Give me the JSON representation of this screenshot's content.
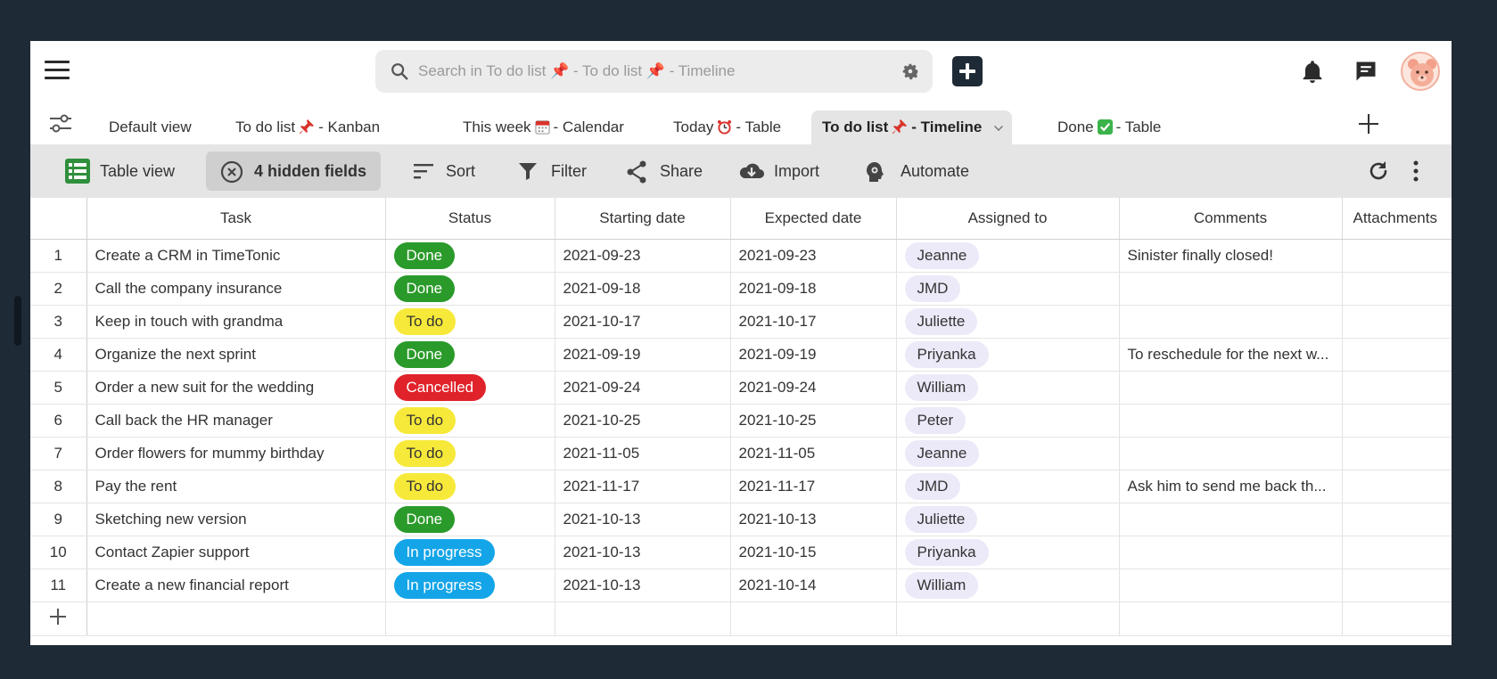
{
  "topbar": {
    "search_placeholder": "Search in To do list 📌 - To do list 📌 - Timeline"
  },
  "tabs": [
    {
      "label": "Default view"
    },
    {
      "label": "To do list",
      "suffix": "- Kanban"
    },
    {
      "label": "This week",
      "suffix": "- Calendar"
    },
    {
      "label": "Today",
      "suffix": "- Table"
    },
    {
      "label": "To do list",
      "suffix": "- Timeline"
    },
    {
      "label": "Done",
      "suffix": "- Table"
    }
  ],
  "toolbar": {
    "table_view": "Table view",
    "hidden_fields": "4 hidden fields",
    "sort": "Sort",
    "filter": "Filter",
    "share": "Share",
    "import": "Import",
    "automate": "Automate"
  },
  "columns": [
    "Task",
    "Status",
    "Starting date",
    "Expected date",
    "Assigned to",
    "Comments",
    "Attachments"
  ],
  "status_colors": {
    "Done": {
      "bg": "#2a9a2a",
      "fg": "#ffffff"
    },
    "To do": {
      "bg": "#f7e93a",
      "fg": "#333333"
    },
    "Cancelled": {
      "bg": "#e0222a",
      "fg": "#ffffff"
    },
    "In progress": {
      "bg": "#14a5e8",
      "fg": "#ffffff"
    }
  },
  "rows": [
    {
      "n": "1",
      "task": "Create a CRM in TimeTonic",
      "status": "Done",
      "start": "2021-09-23",
      "expected": "2021-09-23",
      "assigned": "Jeanne",
      "comment": "Sinister finally closed!"
    },
    {
      "n": "2",
      "task": "Call the company insurance",
      "status": "Done",
      "start": "2021-09-18",
      "expected": "2021-09-18",
      "assigned": "JMD",
      "comment": ""
    },
    {
      "n": "3",
      "task": "Keep in touch with grandma",
      "status": "To do",
      "start": "2021-10-17",
      "expected": "2021-10-17",
      "assigned": "Juliette",
      "comment": ""
    },
    {
      "n": "4",
      "task": "Organize the next sprint",
      "status": "Done",
      "start": "2021-09-19",
      "expected": "2021-09-19",
      "assigned": "Priyanka",
      "comment": "To reschedule for the next w..."
    },
    {
      "n": "5",
      "task": "Order a new suit for the wedding",
      "status": "Cancelled",
      "start": "2021-09-24",
      "expected": "2021-09-24",
      "assigned": "William",
      "comment": ""
    },
    {
      "n": "6",
      "task": "Call back the HR manager",
      "status": "To do",
      "start": "2021-10-25",
      "expected": "2021-10-25",
      "assigned": "Peter",
      "comment": ""
    },
    {
      "n": "7",
      "task": "Order flowers for mummy birthday",
      "status": "To do",
      "start": "2021-11-05",
      "expected": "2021-11-05",
      "assigned": "Jeanne",
      "comment": ""
    },
    {
      "n": "8",
      "task": "Pay the rent",
      "status": "To do",
      "start": "2021-11-17",
      "expected": "2021-11-17",
      "assigned": "JMD",
      "comment": "Ask him to send me back th..."
    },
    {
      "n": "9",
      "task": "Sketching new version",
      "status": "Done",
      "start": "2021-10-13",
      "expected": "2021-10-13",
      "assigned": "Juliette",
      "comment": ""
    },
    {
      "n": "10",
      "task": "Contact Zapier support",
      "status": "In progress",
      "start": "2021-10-13",
      "expected": "2021-10-15",
      "assigned": "Priyanka",
      "comment": ""
    },
    {
      "n": "11",
      "task": "Create a new financial report",
      "status": "In progress",
      "start": "2021-10-13",
      "expected": "2021-10-14",
      "assigned": "William",
      "comment": ""
    }
  ]
}
